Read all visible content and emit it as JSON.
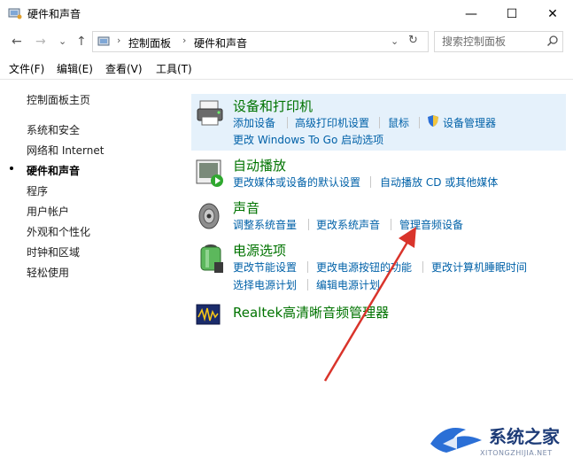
{
  "window": {
    "title": "硬件和声音",
    "minimize_glyph": "—",
    "maximize_glyph": "☐",
    "close_glyph": "✕"
  },
  "nav": {
    "back_glyph": "←",
    "forward_glyph": "→",
    "history_glyph": "⌄",
    "up_glyph": "↑",
    "refresh_glyph": "↻"
  },
  "address": {
    "crumbs": [
      "控制面板",
      "硬件和声音"
    ],
    "dropdown_glyph": "⌄"
  },
  "search": {
    "placeholder": "搜索控制面板"
  },
  "menu": [
    "文件(F)",
    "编辑(E)",
    "查看(V)",
    "工具(T)"
  ],
  "sidebar": {
    "items": [
      {
        "label": "控制面板主页"
      },
      {
        "label": "系统和安全"
      },
      {
        "label": "网络和 Internet"
      },
      {
        "label": "硬件和声音"
      },
      {
        "label": "程序"
      },
      {
        "label": "用户帐户"
      },
      {
        "label": "外观和个性化"
      },
      {
        "label": "时钟和区域"
      },
      {
        "label": "轻松使用"
      }
    ],
    "active_index": 3
  },
  "categories": [
    {
      "title": "设备和打印机",
      "icon": "printer-icon",
      "links": [
        [
          "添加设备",
          "高级打印机设置",
          "鼠标",
          "设备管理器"
        ],
        [
          "更改 Windows To Go 启动选项"
        ]
      ]
    },
    {
      "title": "自动播放",
      "icon": "autoplay-icon",
      "links": [
        [
          "更改媒体或设备的默认设置",
          "自动播放 CD 或其他媒体"
        ]
      ]
    },
    {
      "title": "声音",
      "icon": "speaker-icon",
      "links": [
        [
          "调整系统音量",
          "更改系统声音",
          "管理音频设备"
        ]
      ]
    },
    {
      "title": "电源选项",
      "icon": "battery-icon",
      "links": [
        [
          "更改节能设置",
          "更改电源按钮的功能",
          "更改计算机睡眠时间"
        ],
        [
          "选择电源计划",
          "编辑电源计划"
        ]
      ]
    },
    {
      "title": "Realtek高清晰音频管理器",
      "icon": "realtek-audio-icon",
      "links": []
    }
  ],
  "watermark": {
    "text": "系统之家",
    "sub": "XITONGZHIJIA.NET"
  },
  "colors": {
    "link": "#0061a8",
    "category_title": "#007300",
    "highlight": "#e5f1fb",
    "arrow": "#d9342b"
  }
}
